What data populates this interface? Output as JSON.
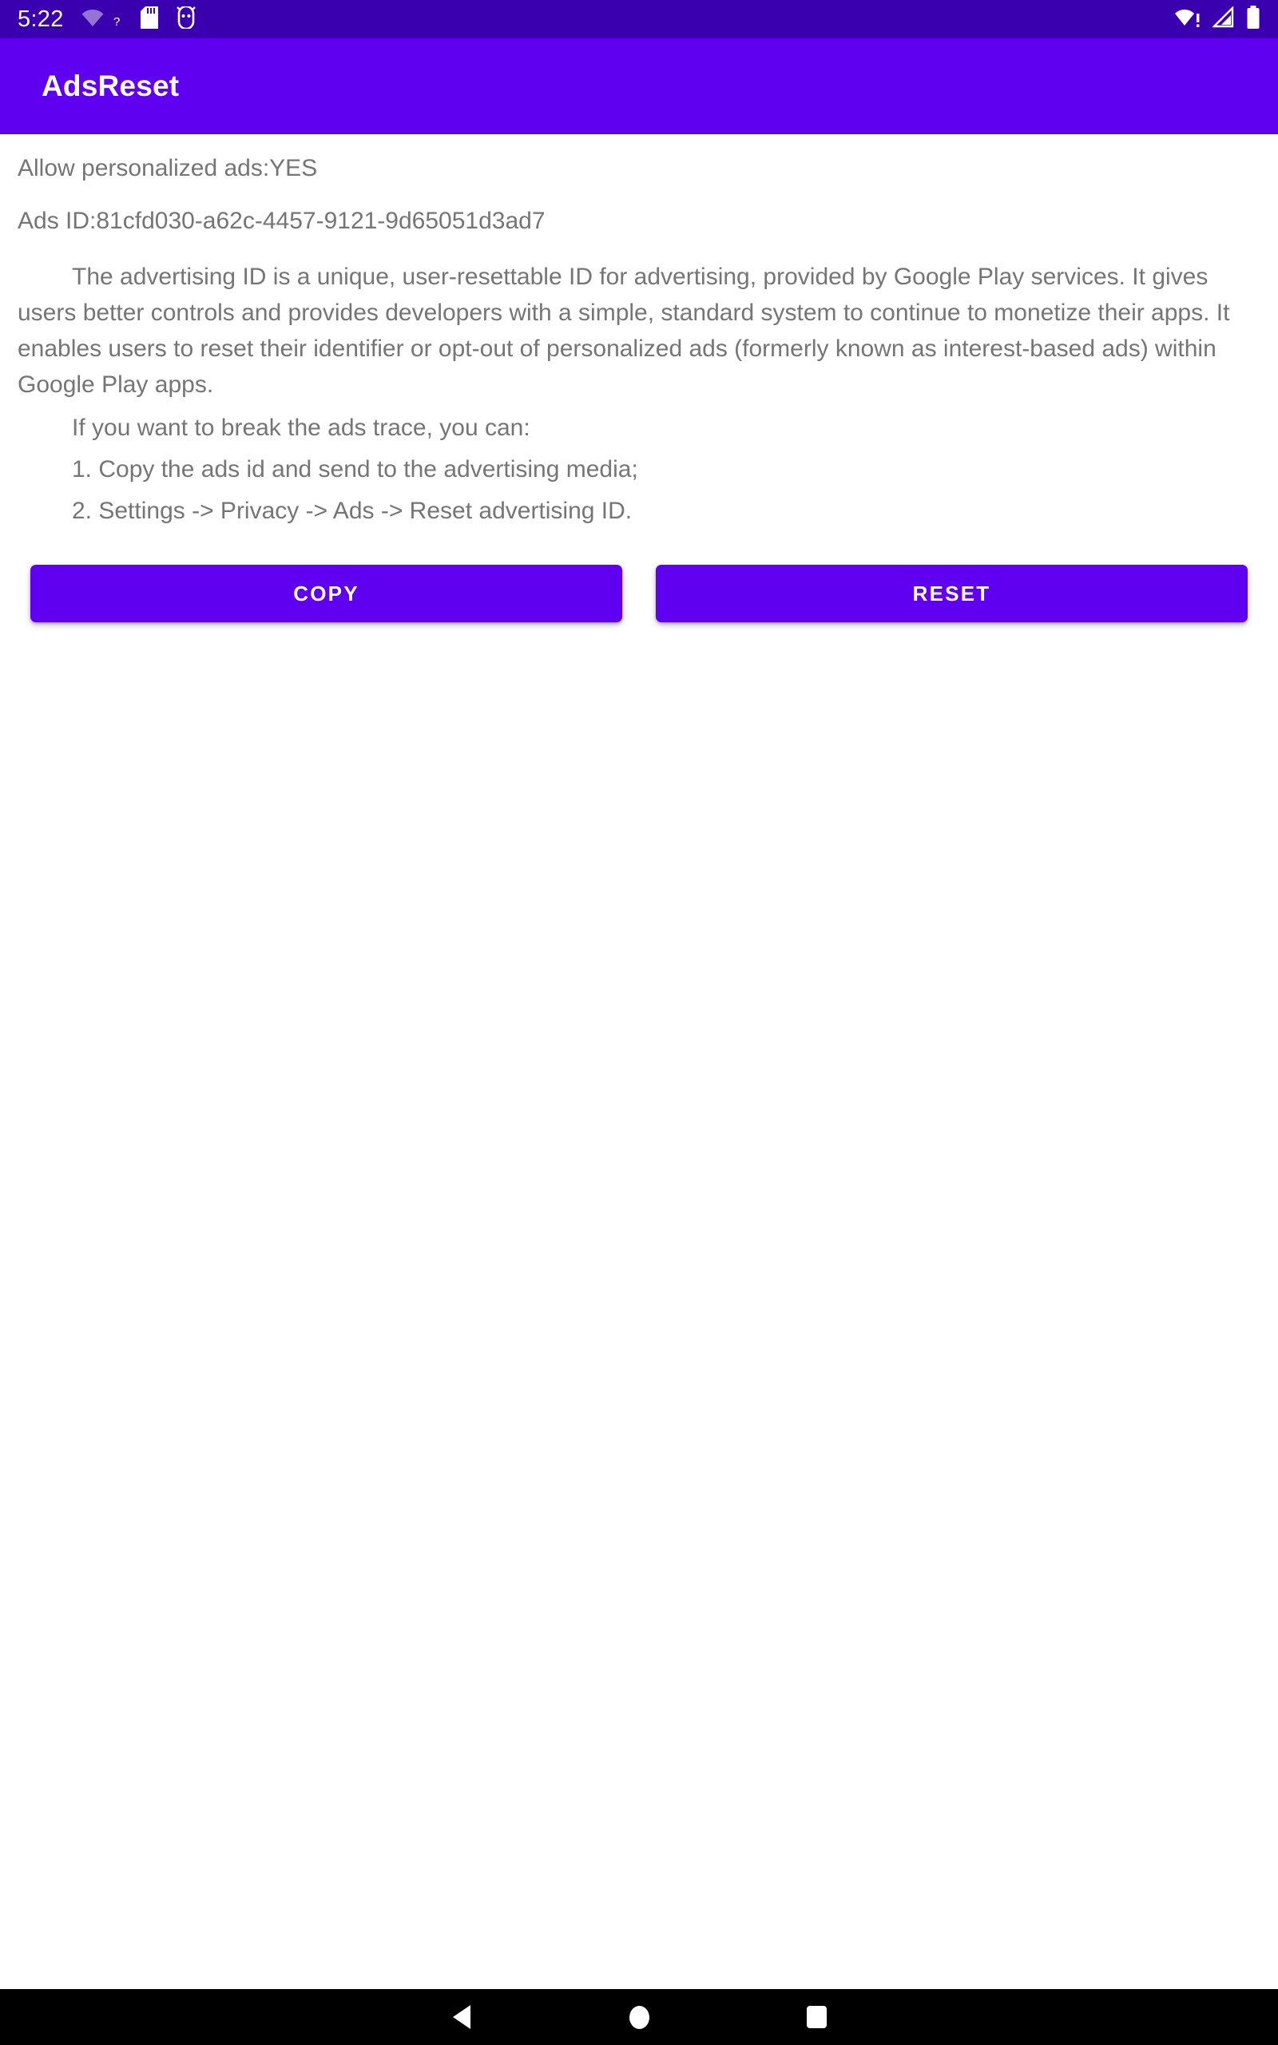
{
  "status_bar": {
    "clock": "5:22",
    "left_icons": [
      "wifi-question-icon",
      "sd-card-icon",
      "android-debug-icon"
    ],
    "right_icons": [
      "wifi-alert-icon",
      "cell-signal-icon",
      "battery-full-icon"
    ],
    "background_color": "#3a00b0"
  },
  "app_bar": {
    "title": "AdsReset",
    "background_color": "#5f00f0",
    "title_color": "#ffffff"
  },
  "content": {
    "ads_state_label": "Allow personalized ads:YES",
    "ads_id_label": "Ads ID:81cfd030-a62c-4457-9121-9d65051d3ad7",
    "intro_paragraph": "The advertising ID is a unique, user-resettable ID for advertising, provided by Google Play services. It gives users better controls and provides developers with a simple, standard system to continue to monetize their apps. It enables users to reset their identifier or opt-out of personalized ads (formerly known as interest-based ads) within Google Play apps.",
    "hint_line": "If you want to break the ads trace, you can:",
    "steps": [
      "1. Copy the ads id and send to the advertising media;",
      "2. Settings -> Privacy -> Ads -> Reset advertising ID."
    ],
    "text_color": "#757575"
  },
  "buttons": {
    "copy_label": "COPY",
    "reset_label": "RESET",
    "fill_color": "#5f00f0",
    "text_color": "#ffffff"
  },
  "nav_bar": {
    "background_color": "#000000",
    "items": [
      "back-icon",
      "home-icon",
      "recents-icon"
    ]
  }
}
